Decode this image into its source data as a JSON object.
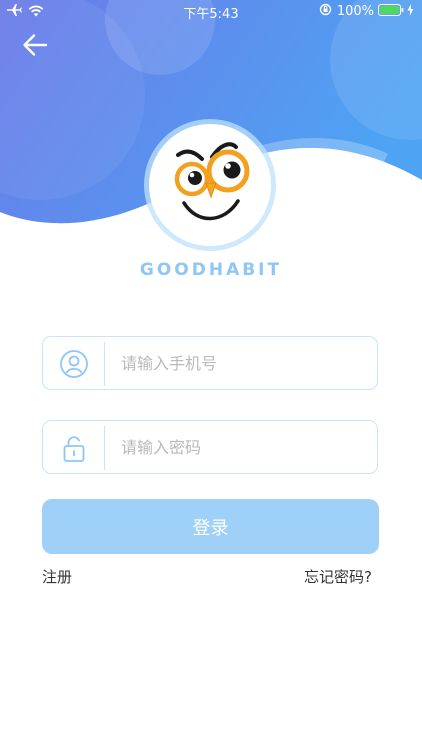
{
  "status_bar": {
    "time": "下午5:43",
    "battery_percent": "100%"
  },
  "brand": {
    "name": "GOODHABIT"
  },
  "form": {
    "phone_placeholder": "请输入手机号",
    "password_placeholder": "请输入密码",
    "login_label": "登录",
    "register_label": "注册",
    "forgot_label": "忘记密码?"
  },
  "icons": {
    "back": "arrow-left-icon",
    "phone_field": "user-icon",
    "password_field": "lock-icon",
    "airplane": "airplane-icon",
    "wifi": "wifi-icon",
    "rotation_lock": "rotation-lock-icon",
    "battery": "battery-icon",
    "charging": "charging-icon"
  },
  "colors": {
    "header_gradient_start": "#6b79ea",
    "header_gradient_end": "#4fa2f2",
    "accent": "#8fc6f3",
    "button": "#9fd0f7",
    "field_border": "#c9e3f8",
    "battery_fill": "#4cd964"
  }
}
